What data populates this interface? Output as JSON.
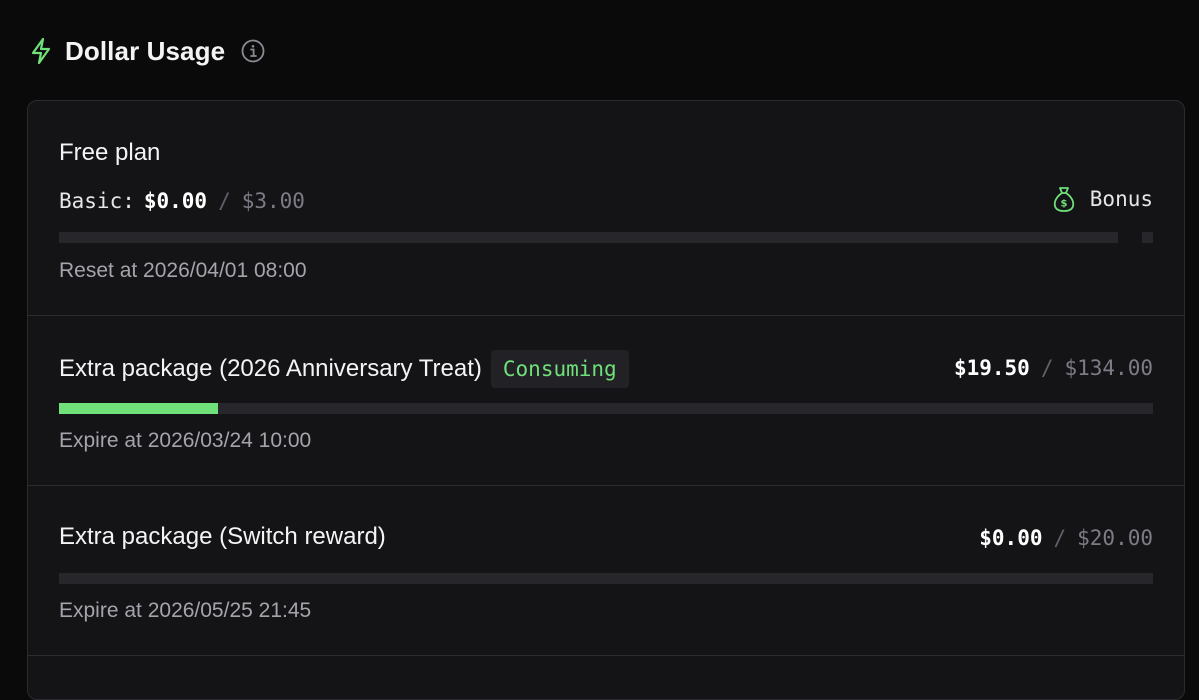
{
  "header": {
    "title": "Dollar Usage",
    "icon": "bolt-icon",
    "info_icon": "info-icon",
    "accent_color": "#6fe07a"
  },
  "free_plan": {
    "name": "Free plan",
    "basic_label": "Basic:",
    "used": "$0.00",
    "separator": "/",
    "total": "$3.00",
    "bonus_label": "Bonus",
    "bonus_icon": "money-bag-icon",
    "progress": 0.0,
    "reset_text": "Reset at 2026/04/01 08:00"
  },
  "packages": [
    {
      "name": "Extra package (2026 Anniversary Treat)",
      "badge": "Consuming",
      "used": "$19.50",
      "separator": "/",
      "total": "$134.00",
      "progress": 0.1455,
      "expire_text": "Expire at 2026/03/24 10:00"
    },
    {
      "name": "Extra package (Switch reward)",
      "badge": "",
      "used": "$0.00",
      "separator": "/",
      "total": "$20.00",
      "progress": 0.0,
      "expire_text": "Expire at 2026/05/25 21:45"
    }
  ]
}
